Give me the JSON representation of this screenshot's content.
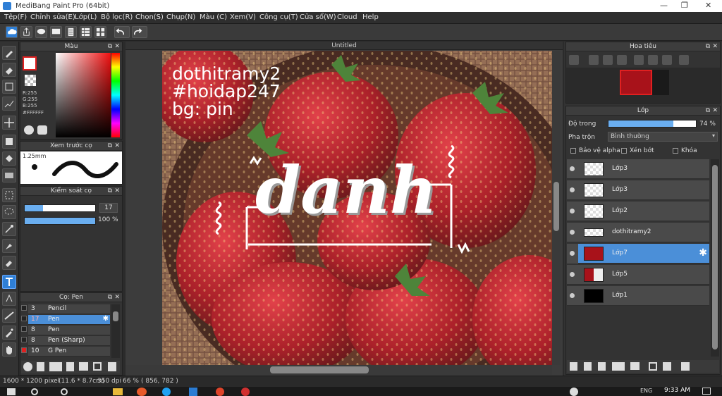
{
  "window": {
    "title": "MediBang Paint Pro (64bit)"
  },
  "menu": [
    "Tệp(F)",
    "Chỉnh sửa(E)",
    "Lớp(L)",
    "Bộ lọc(R)",
    "Chọn(S)",
    "Chụp(N)",
    "Màu (C)",
    "Xem(V)",
    "Công cụ(T)",
    "Cửa sổ(W)",
    "Cloud",
    "Help"
  ],
  "color_panel": {
    "title": "Màu",
    "r": "R:255",
    "g": "G:255",
    "b": "B:255",
    "hex": "#FFFFFF"
  },
  "brush_preview": {
    "title": "Xem trước cọ",
    "size": "1.25mm"
  },
  "brush_control": {
    "title": "Kiểm soát cọ",
    "size_value": "17",
    "opacity_value": "100 %",
    "size_level": 0.26,
    "opacity_level": 1.0
  },
  "brush_list": {
    "title": "Cọ: Pen",
    "items": [
      {
        "num": "3",
        "name": "Pencil"
      },
      {
        "num": "17",
        "name": "Pen"
      },
      {
        "num": "8",
        "name": "Pen"
      },
      {
        "num": "8",
        "name": "Pen (Sharp)"
      },
      {
        "num": "10",
        "name": "G Pen"
      }
    ]
  },
  "canvas": {
    "tab_title": "Untitled",
    "text_line1": "dothitramy2",
    "text_line2": "#hoidap247",
    "text_line3": "bg: pin",
    "logo_text": "danh"
  },
  "navigator": {
    "title": "Hoa tiêu"
  },
  "layers": {
    "title": "Lớp",
    "opacity_label": "Độ trong",
    "opacity_value": "74 %",
    "opacity_level": 0.74,
    "blend_label": "Pha trộn",
    "blend_value": "Bình thường",
    "protect_alpha": "Bảo vệ alpha",
    "clipping": "Xén bớt",
    "lock": "Khóa",
    "items": [
      {
        "name": "Lớp3"
      },
      {
        "name": "Lớp3"
      },
      {
        "name": "Lớp2"
      },
      {
        "name": "dothitramy2"
      },
      {
        "name": "Lớp7"
      },
      {
        "name": "Lớp5"
      },
      {
        "name": "Lớp1"
      }
    ]
  },
  "status": {
    "size": "1600 * 1200 pixel",
    "cm": "(11.6 * 8.7cm)",
    "dpi": "350 dpi",
    "zoom": "66 %",
    "coords": "( 856, 782 )"
  },
  "taskbar": {
    "time": "9:33 AM",
    "lang": "ENG"
  },
  "colors": {
    "accent": "#4b8fd8",
    "primary_swatch": "#ffffff",
    "berry": "#b3121a"
  }
}
